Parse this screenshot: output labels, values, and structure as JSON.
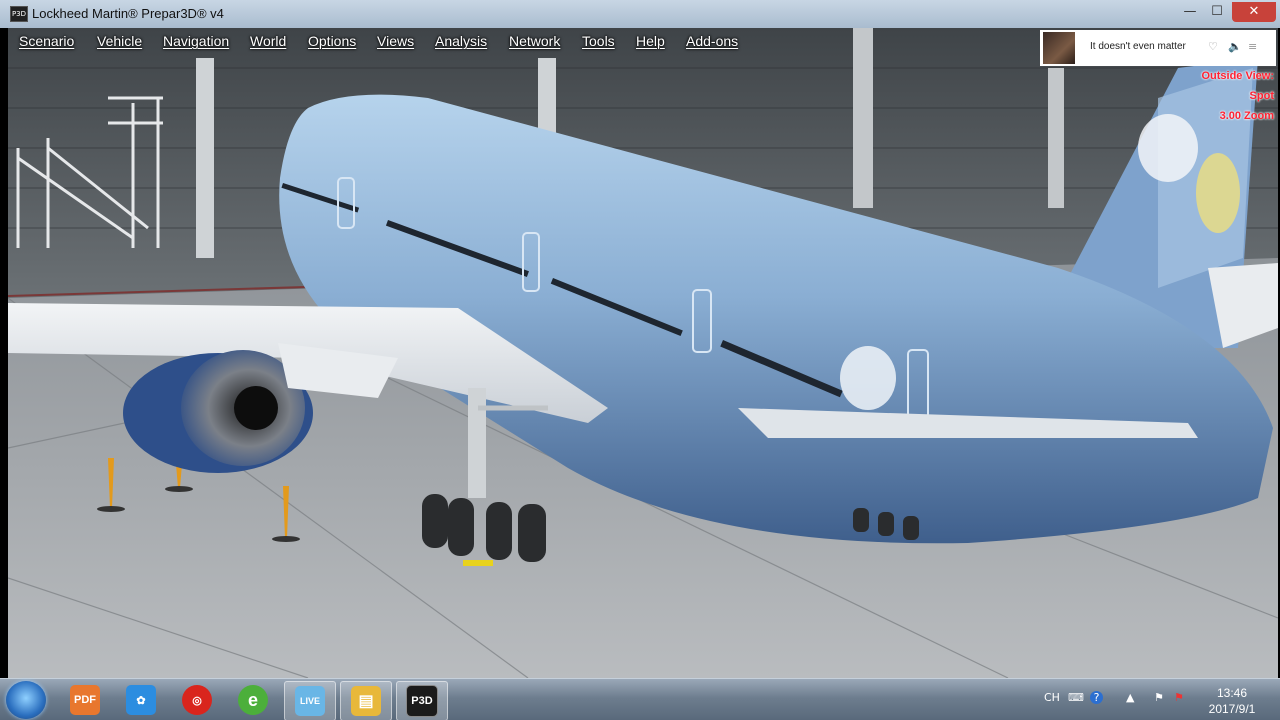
{
  "window": {
    "title": "Lockheed Martin® Prepar3D® v4",
    "icon_label": "P3D",
    "minimize": "—",
    "maximize": "☐",
    "close": "✕"
  },
  "menu": [
    "Scenario",
    "Vehicle",
    "Navigation",
    "World",
    "Options",
    "Views",
    "Analysis",
    "Network",
    "Tools",
    "Help",
    "Add-ons"
  ],
  "music_widget": {
    "song": "It doesn't even matter",
    "heart": "♡",
    "volume": "🔈",
    "list": "≡"
  },
  "view_info": {
    "line1": "Outside View:",
    "line2": "Spot",
    "line3": "3.00 Zoom"
  },
  "taskbar": {
    "apps": [
      {
        "name": "pdf-app",
        "label": "PDF",
        "color": "#e8772e"
      },
      {
        "name": "baidu-app",
        "label": "✿",
        "color": "#2c8de0"
      },
      {
        "name": "netease-music-app",
        "label": "◎",
        "color": "#d9251d"
      },
      {
        "name": "ie-browser-app",
        "label": "e",
        "color": "#4caf3b"
      },
      {
        "name": "live-app",
        "label": "LIVE",
        "color": "#69b6e6"
      },
      {
        "name": "explorer-app",
        "label": "▤",
        "color": "#e8b83a"
      },
      {
        "name": "p3d-app",
        "label": "P3D",
        "color": "#1b1b1b"
      }
    ],
    "tray": {
      "lang": "CH",
      "ime": "⌨",
      "help": "?",
      "arrow": "▲",
      "flag": "⚑"
    },
    "time": "13:46",
    "date": "2017/9/1"
  }
}
